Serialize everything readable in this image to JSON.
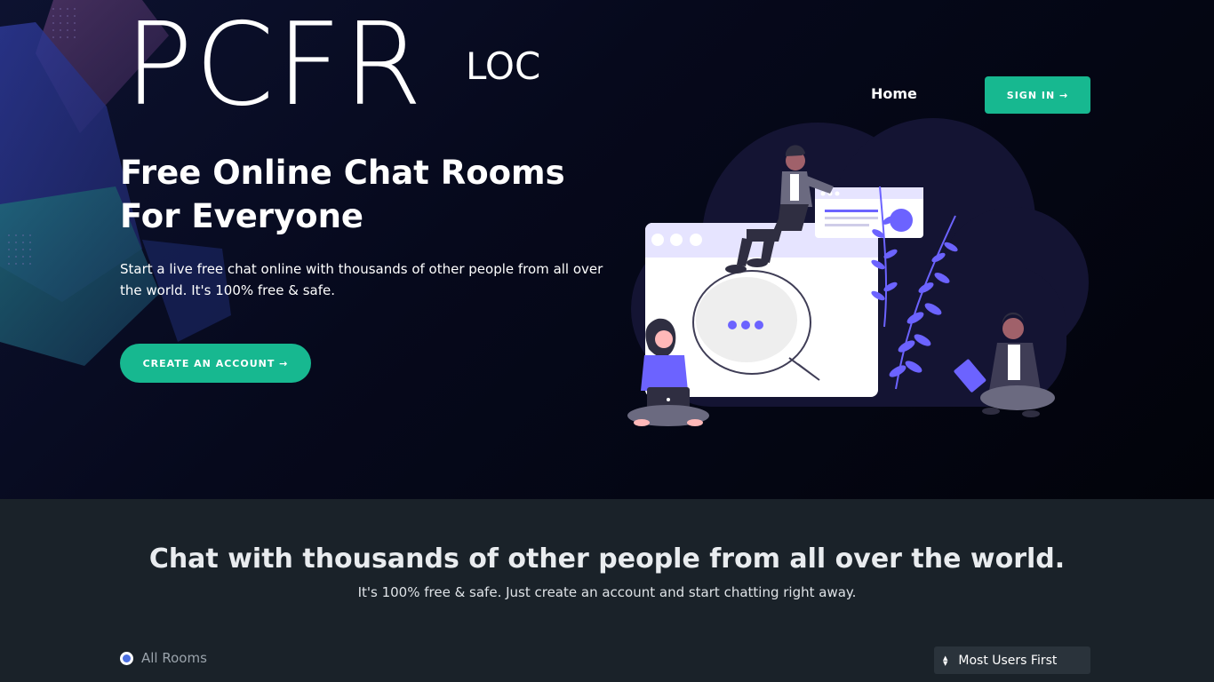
{
  "brand": {
    "logo": "PCFR",
    "logo_sub": "LOC"
  },
  "nav": {
    "home": "Home",
    "signin": "SIGN IN →"
  },
  "hero": {
    "title_line1": "Free Online Chat Rooms",
    "title_line2": "For Everyone",
    "description": "Start a live free chat online with thousands of other people from all over the world. It's 100% free & safe.",
    "cta": "CREATE AN ACCOUNT →"
  },
  "section": {
    "title": "Chat with thousands of other people from all over the world.",
    "subtitle": "It's 100% free & safe. Just create an account and start chatting right away."
  },
  "filters": {
    "all_rooms": "All Rooms",
    "sort_selected": "Most Users First"
  },
  "colors": {
    "accent": "#17b890",
    "hero_bg": "#02030a",
    "section_bg": "#1a2229",
    "illustration_purple": "#6c63ff"
  }
}
